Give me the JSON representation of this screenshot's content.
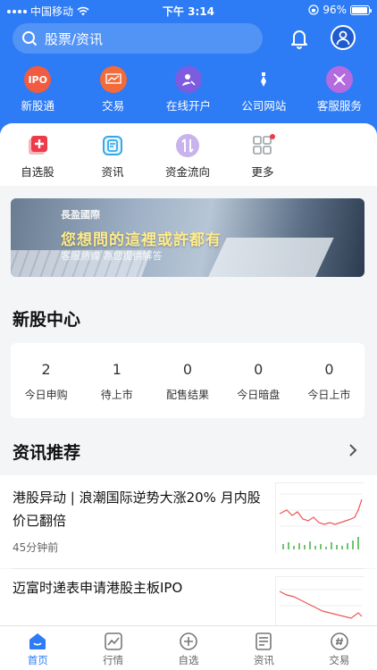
{
  "status_bar": {
    "carrier": "中国移动",
    "time": "下午 3:14",
    "battery": "96%",
    "battery_level": 0.96
  },
  "search": {
    "placeholder": "股票/资讯"
  },
  "top_services": [
    {
      "label": "新股通",
      "icon": "ipo-icon",
      "badge": "IPO",
      "color": "#f25b3f"
    },
    {
      "label": "交易",
      "icon": "trade-chart-icon",
      "color": "#f36b3b"
    },
    {
      "label": "在线开户",
      "icon": "open-account-icon",
      "color": "#7d5ce0"
    },
    {
      "label": "公司网站",
      "icon": "company-site-icon",
      "color": "#2d7cf5"
    },
    {
      "label": "客服服务",
      "icon": "customer-service-icon",
      "color": "#b46be0"
    }
  ],
  "quick_actions": [
    {
      "label": "自选股",
      "icon": "watchlist-add-icon",
      "color": "#ec3b4b"
    },
    {
      "label": "资讯",
      "icon": "news-icon",
      "color": "#35a8e8"
    },
    {
      "label": "资金流向",
      "icon": "fund-flow-icon",
      "color": "#b08be0"
    },
    {
      "label": "更多",
      "icon": "more-grid-icon",
      "color": "#9aa0a6"
    }
  ],
  "banner": {
    "logo_text": "長盈國際",
    "slogan": "您想問的這裡或許都有",
    "subtitle": "客服熱線 為您提供解答"
  },
  "ipo_center": {
    "title": "新股中心",
    "stats": [
      {
        "value": "2",
        "label": "今日申购"
      },
      {
        "value": "1",
        "label": "待上市"
      },
      {
        "value": "0",
        "label": "配售结果"
      },
      {
        "value": "0",
        "label": "今日暗盘"
      },
      {
        "value": "0",
        "label": "今日上市"
      }
    ]
  },
  "news_section": {
    "title": "资讯推荐",
    "items": [
      {
        "title": "港股异动 | 浪潮国际逆势大涨20% 月内股价已翻倍",
        "time": "45分钟前"
      },
      {
        "title": "迈富时递表申请港股主板IPO",
        "time": ""
      }
    ]
  },
  "tabbar": [
    {
      "label": "首页",
      "icon": "home-icon",
      "active": true
    },
    {
      "label": "行情",
      "icon": "market-icon",
      "active": false
    },
    {
      "label": "自选",
      "icon": "watchlist-icon",
      "active": false
    },
    {
      "label": "资讯",
      "icon": "news-doc-icon",
      "active": false
    },
    {
      "label": "交易",
      "icon": "trade-icon",
      "active": false
    }
  ],
  "colors": {
    "primary": "#2d7cf5",
    "background": "#f4f5f7"
  }
}
